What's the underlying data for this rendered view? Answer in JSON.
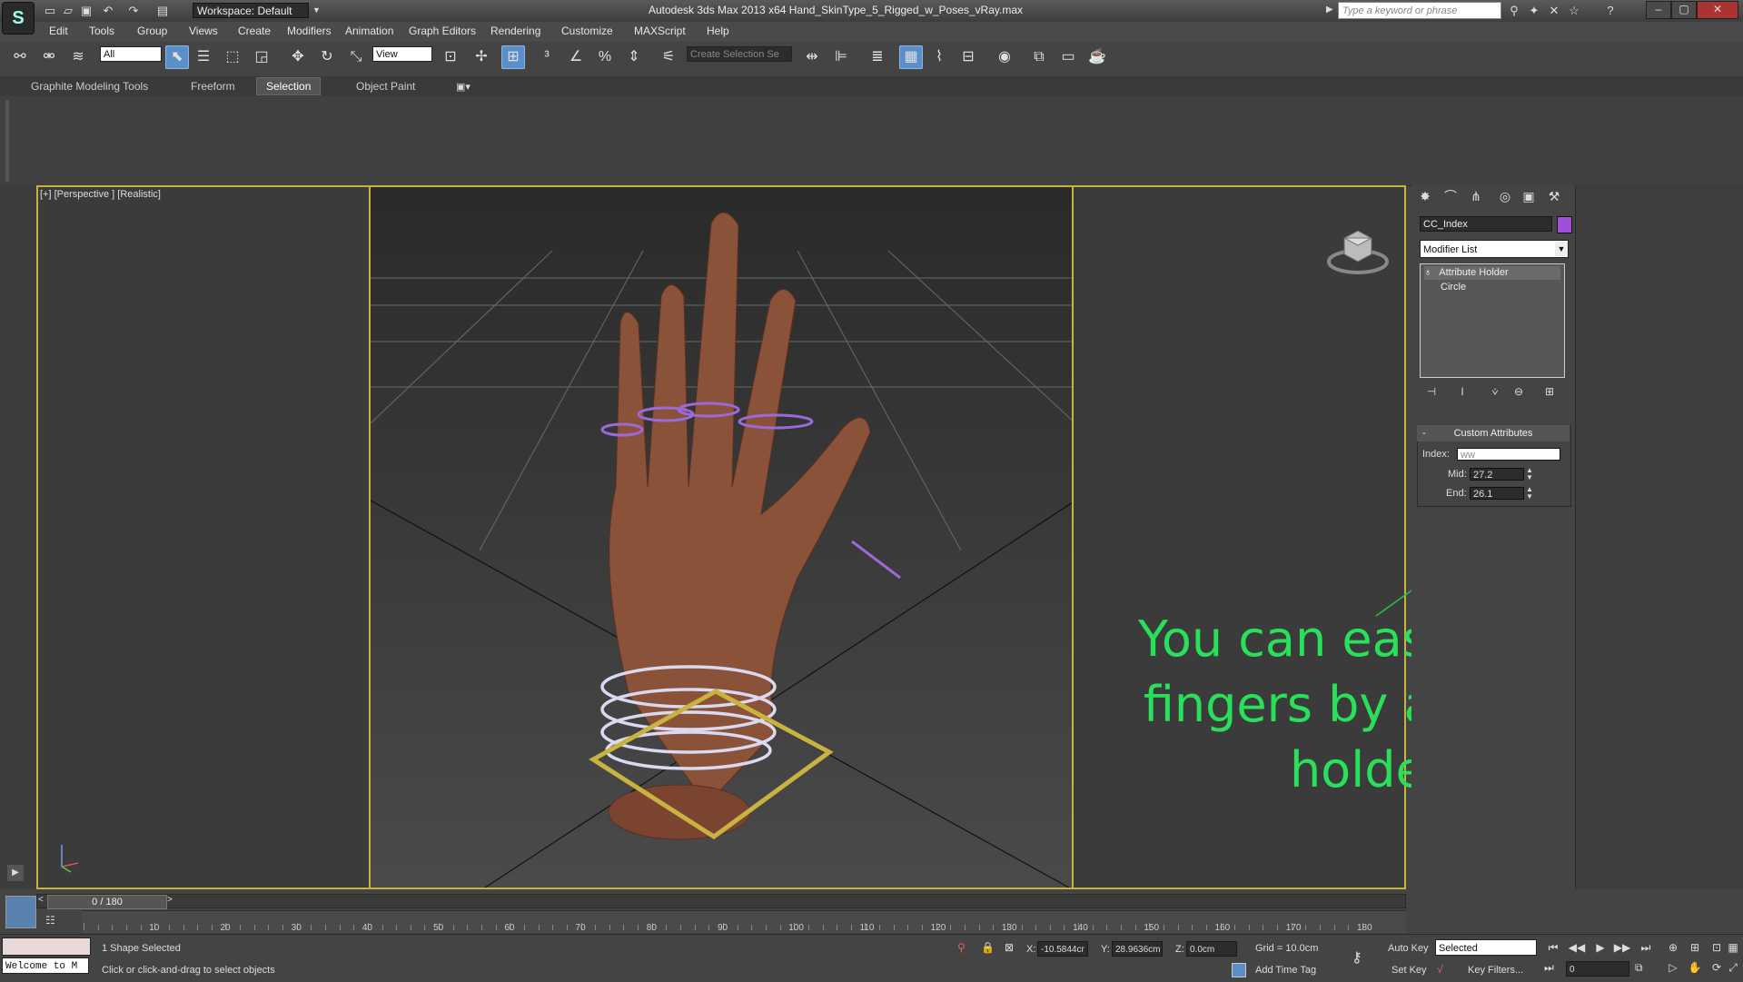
{
  "titlebar": {
    "workspace": "Workspace: Default",
    "title": "Autodesk 3ds Max  2013 x64      Hand_SkinType_5_Rigged_w_Poses_vRay.max",
    "search_placeholder": "Type a keyword or phrase"
  },
  "menu": [
    "Edit",
    "Tools",
    "Group",
    "Views",
    "Create",
    "Modifiers",
    "Animation",
    "Graph Editors",
    "Rendering",
    "Customize",
    "MAXScript",
    "Help"
  ],
  "toolbar": {
    "filter": "All",
    "ref_coord": "View",
    "named_selection": "Create Selection Se"
  },
  "ribbon": {
    "tabs": [
      "Graphite Modeling Tools",
      "Freeform",
      "Selection",
      "Object Paint"
    ]
  },
  "viewport": {
    "label": "[+] [Perspective ] [Realistic]"
  },
  "annotation": {
    "line1": "You can easily bend",
    "line2": "fingers by attribute",
    "line3": "holders"
  },
  "command_panel": {
    "object_name": "CC_Index",
    "object_color": "#a050d8",
    "modifier_list": "Modifier List",
    "stack": [
      "Attribute Holder",
      "Circle"
    ],
    "custom_attributes": {
      "title": "Custom Attributes",
      "index_label": "Index:",
      "index_value": "ww",
      "mid_label": "Mid:",
      "mid_value": "27.2",
      "end_label": "End:",
      "end_value": "26.1"
    }
  },
  "timeline": {
    "frame": "0 / 180",
    "ticks": [
      "10",
      "20",
      "30",
      "40",
      "50",
      "60",
      "70",
      "80",
      "90",
      "100",
      "110",
      "120",
      "130",
      "140",
      "150",
      "160",
      "170",
      "180"
    ]
  },
  "status": {
    "welcome": "Welcome to M",
    "selection": "1 Shape Selected",
    "prompt": "Click or click-and-drag to select objects",
    "x_label": "X:",
    "x_value": "-10.5844cr",
    "y_label": "Y:",
    "y_value": "28.9636cm",
    "z_label": "Z:",
    "z_value": "0.0cm",
    "grid": "Grid = 10.0cm",
    "add_time_tag": "Add Time Tag",
    "auto_key": "Auto Key",
    "set_key": "Set Key",
    "selected_dd": "Selected",
    "key_filters": "Key Filters...",
    "frame_field": "0"
  }
}
